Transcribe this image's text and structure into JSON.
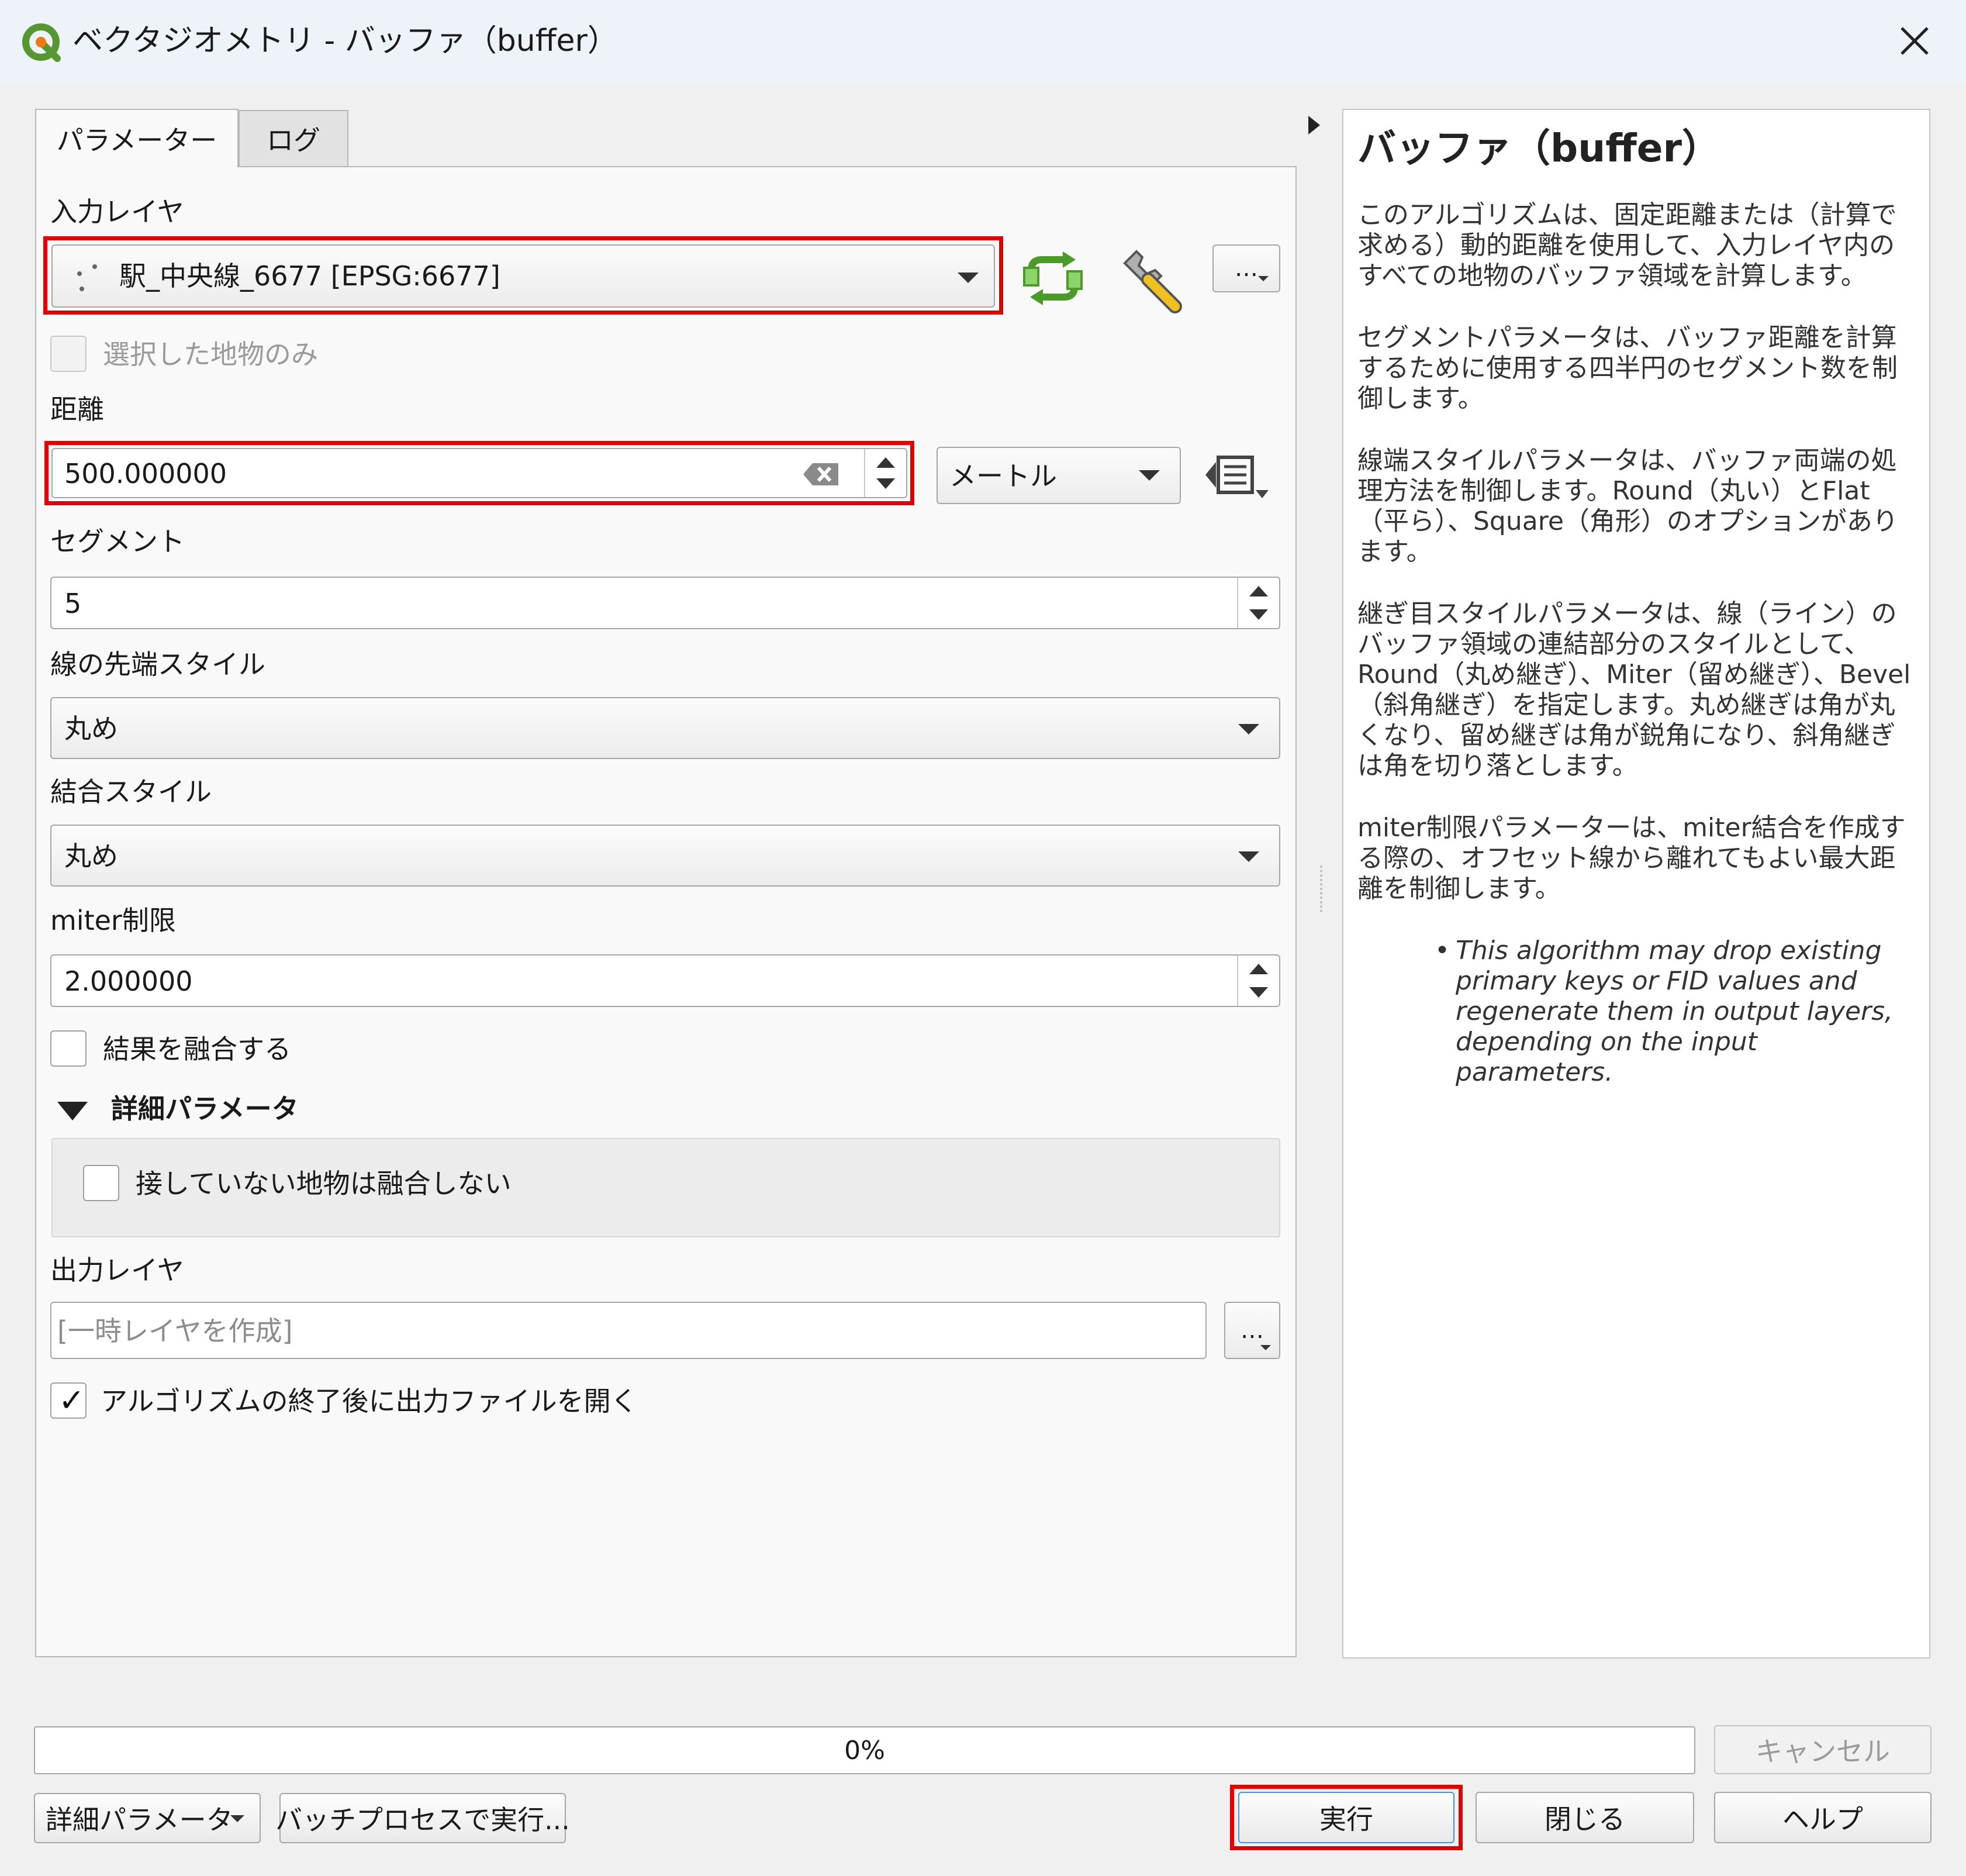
{
  "window": {
    "title": "ベクタジオメトリ - バッファ（buffer）"
  },
  "tabs": [
    {
      "label": "パラメーター",
      "active": true
    },
    {
      "label": "ログ",
      "active": false
    }
  ],
  "params": {
    "input_layer": {
      "label": "入力レイヤ",
      "value": "駅_中央線_6677 [EPSG:6677]",
      "more_button": "…"
    },
    "selected_only": {
      "label": "選択した地物のみ",
      "checked": false,
      "enabled": false
    },
    "distance": {
      "label": "距離",
      "value": "500.000000",
      "unit": "メートル"
    },
    "segments": {
      "label": "セグメント",
      "value": "5"
    },
    "end_cap_style": {
      "label": "線の先端スタイル",
      "value": "丸め"
    },
    "join_style": {
      "label": "結合スタイル",
      "value": "丸め"
    },
    "miter_limit": {
      "label": "miter制限",
      "value": "2.000000"
    },
    "dissolve": {
      "label": "結果を融合する",
      "checked": false
    },
    "advanced": {
      "label": "詳細パラメータ",
      "expanded": true,
      "separate_disjoint": {
        "label": "接していない地物は融合しない",
        "checked": false
      }
    },
    "output_layer": {
      "label": "出力レイヤ",
      "placeholder": "[一時レイヤを作成]",
      "more_button": "…"
    },
    "open_output": {
      "label": "アルゴリズムの終了後に出力ファイルを開く",
      "checked": true
    }
  },
  "help": {
    "title": "バッファ（buffer）",
    "paragraphs": [
      "このアルゴリズムは、固定距離または（計算で求める）動的距離を使用して、入力レイヤ内のすべての地物のバッファ領域を計算します。",
      "セグメントパラメータは、バッファ距離を計算するために使用する四半円のセグメント数を制御します。",
      "線端スタイルパラメータは、バッファ両端の処理方法を制御します。Round（丸い）とFlat（平ら）、Square（角形）のオプションがあります。",
      "継ぎ目スタイルパラメータは、線（ライン）のバッファ領域の連結部分のスタイルとして、Round（丸め継ぎ）、Miter（留め継ぎ）、Bevel（斜角継ぎ）を指定します。丸め継ぎは角が丸くなり、留め継ぎは角が鋭角になり、斜角継ぎは角を切り落とします。",
      "miter制限パラメーターは、miter結合を作成する際の、オフセット線から離れてもよい最大距離を制御します。"
    ],
    "note": "This algorithm may drop existing primary keys or FID values and regenerate them in output layers, depending on the input parameters."
  },
  "footer": {
    "progress": 0,
    "progress_text": "0%",
    "cancel_label": "キャンセル",
    "advanced_label": "詳細パラメータ",
    "batch_label": "バッチプロセスで実行...",
    "run_label": "実行",
    "close_label": "閉じる",
    "help_label": "ヘルプ"
  },
  "colors": {
    "highlight": "#e00000",
    "qgis_green": "#589632",
    "qgis_yellow": "#ee7913"
  },
  "icons": [
    "qgis-logo-icon",
    "close-icon",
    "point-layer-icon",
    "dropdown-caret-icon",
    "iterate-icon",
    "wrench-icon",
    "clear-icon",
    "spin-arrows-icon",
    "data-defined-icon",
    "collapse-triangle-icon",
    "collapse-panel-arrow-icon",
    "checkmark-icon"
  ]
}
